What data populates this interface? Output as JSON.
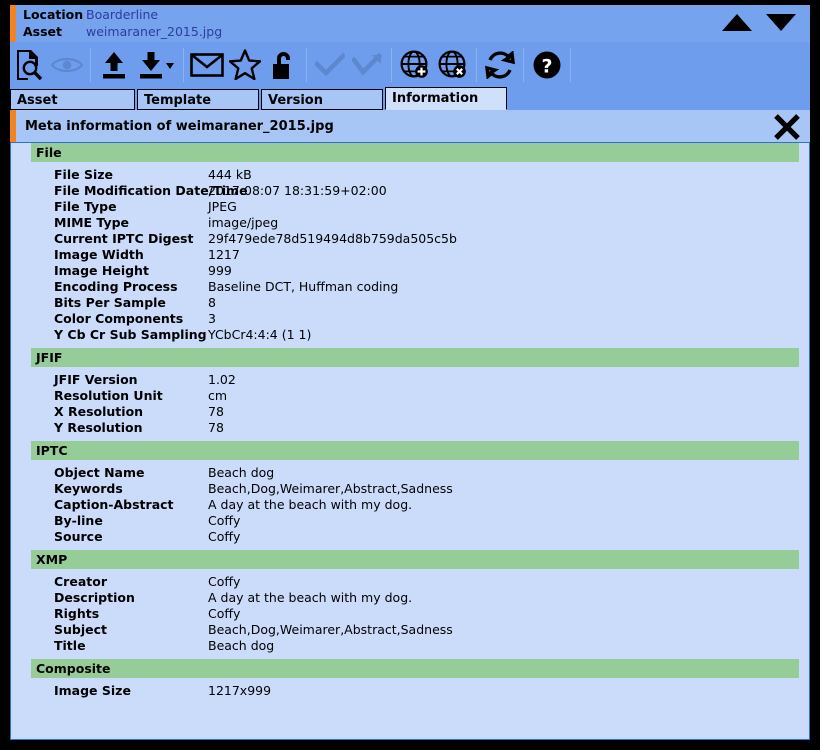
{
  "header": {
    "location_label": "Location",
    "location_value": "Boarderline",
    "asset_label": "Asset",
    "asset_value": "weimaraner_2015.jpg",
    "nav_up": "previous-asset",
    "nav_down": "next-asset"
  },
  "toolbar": {
    "buttons": [
      {
        "name": "inspect-document-icon",
        "title": "Inspect asset",
        "enabled": true
      },
      {
        "name": "eye-preview-icon",
        "title": "Preview",
        "enabled": false
      },
      {
        "name": "upload-icon",
        "title": "Upload",
        "enabled": true
      },
      {
        "name": "download-icon",
        "title": "Download",
        "enabled": true
      },
      {
        "name": "envelope-mail-icon",
        "title": "Send by mail",
        "enabled": true
      },
      {
        "name": "star-favorite-icon",
        "title": "Favourite",
        "enabled": true
      },
      {
        "name": "unlock-padlock-icon",
        "title": "Unlock",
        "enabled": true
      },
      {
        "name": "check-approve-icon",
        "title": "Approve",
        "enabled": false
      },
      {
        "name": "check-arrow-icon",
        "title": "Approve and forward",
        "enabled": false
      },
      {
        "name": "globe-add-icon",
        "title": "Publish",
        "enabled": true
      },
      {
        "name": "globe-remove-icon",
        "title": "Unpublish",
        "enabled": true
      },
      {
        "name": "refresh-icon",
        "title": "Refresh",
        "enabled": true
      },
      {
        "name": "help-icon",
        "title": "Help",
        "enabled": true
      }
    ]
  },
  "tabs": [
    {
      "label": "Asset",
      "active": false
    },
    {
      "label": "Template",
      "active": false
    },
    {
      "label": "Version",
      "active": false
    },
    {
      "label": "Information",
      "active": true
    }
  ],
  "meta_panel": {
    "title": "Meta information of weimaraner_2015.jpg",
    "close_label": "close-panel"
  },
  "colors": {
    "header_blue": "#76a3ed",
    "toolbar_blue": "#6f9ded",
    "tab_blue": "#a8c6f5",
    "tab_active_blue": "#cfe0fb",
    "panel_blue": "#cbdcfb",
    "section_green": "#95cc98",
    "accent_orange": "#f58220",
    "link_blue": "#2e3c9e",
    "border_black": "#000000"
  },
  "sections": [
    {
      "title": "File",
      "rows": [
        {
          "key": "File Size",
          "value": "444 kB"
        },
        {
          "key": "File Modification Date/Time",
          "value": "2017:08:07 18:31:59+02:00"
        },
        {
          "key": "File Type",
          "value": "JPEG"
        },
        {
          "key": "MIME Type",
          "value": "image/jpeg"
        },
        {
          "key": "Current IPTC Digest",
          "value": "29f479ede78d519494d8b759da505c5b"
        },
        {
          "key": "Image Width",
          "value": "1217"
        },
        {
          "key": "Image Height",
          "value": "999"
        },
        {
          "key": "Encoding Process",
          "value": "Baseline DCT, Huffman coding"
        },
        {
          "key": "Bits Per Sample",
          "value": "8"
        },
        {
          "key": "Color Components",
          "value": "3"
        },
        {
          "key": "Y Cb Cr Sub Sampling",
          "value": "YCbCr4:4:4 (1 1)"
        }
      ]
    },
    {
      "title": "JFIF",
      "rows": [
        {
          "key": "JFIF Version",
          "value": "1.02"
        },
        {
          "key": "Resolution Unit",
          "value": "cm"
        },
        {
          "key": "X Resolution",
          "value": "78"
        },
        {
          "key": "Y Resolution",
          "value": "78"
        }
      ]
    },
    {
      "title": "IPTC",
      "rows": [
        {
          "key": "Object Name",
          "value": "Beach dog"
        },
        {
          "key": "Keywords",
          "value": "Beach,Dog,Weimarer,Abstract,Sadness"
        },
        {
          "key": "Caption-Abstract",
          "value": "A day at the beach with my dog."
        },
        {
          "key": "By-line",
          "value": "Coffy"
        },
        {
          "key": "Source",
          "value": "Coffy"
        }
      ]
    },
    {
      "title": "XMP",
      "rows": [
        {
          "key": "Creator",
          "value": "Coffy"
        },
        {
          "key": "Description",
          "value": "A day at the beach with my dog."
        },
        {
          "key": "Rights",
          "value": "Coffy"
        },
        {
          "key": "Subject",
          "value": "Beach,Dog,Weimarer,Abstract,Sadness"
        },
        {
          "key": "Title",
          "value": "Beach dog"
        }
      ]
    },
    {
      "title": "Composite",
      "rows": [
        {
          "key": "Image Size",
          "value": "1217x999"
        }
      ]
    }
  ]
}
